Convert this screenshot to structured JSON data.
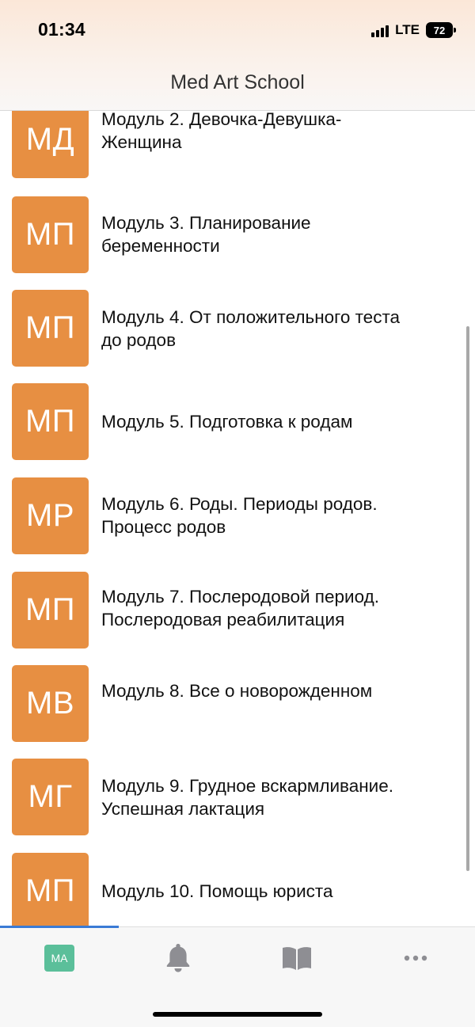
{
  "status_bar": {
    "time": "01:34",
    "network": "LTE",
    "battery": "72"
  },
  "header": {
    "title": "Med Art School"
  },
  "modules": [
    {
      "initials": "МД",
      "lines": [
        "Модуль 2. Девочка-Девушка-",
        "Женщина"
      ]
    },
    {
      "initials": "МП",
      "lines": [
        "Модуль 3. Планирование",
        "беременности"
      ]
    },
    {
      "initials": "МП",
      "lines": [
        "Модуль 4. От положительного теста",
        "до родов"
      ]
    },
    {
      "initials": "МП",
      "lines": [
        "Модуль 5. Подготовка к родам"
      ]
    },
    {
      "initials": "МР",
      "lines": [
        "Модуль 6. Роды. Периоды родов.",
        "Процесс родов"
      ]
    },
    {
      "initials": "МП",
      "lines": [
        "Модуль 7. Послеродовой период.",
        "Послеродовая реабилитация"
      ]
    },
    {
      "initials": "МВ",
      "lines": [
        "Модуль 8. Все о новорожденном"
      ]
    },
    {
      "initials": "МГ",
      "lines": [
        "Модуль 9. Грудное вскармливание.",
        "Успешная лактация"
      ]
    },
    {
      "initials": "МП",
      "lines": [
        "Модуль 10. Помощь юриста"
      ]
    }
  ],
  "tabbar": {
    "home_badge": "MA",
    "tabs": [
      {
        "icon": "home-badge-icon"
      },
      {
        "icon": "bell-icon"
      },
      {
        "icon": "book-icon"
      },
      {
        "icon": "more-icon"
      }
    ]
  },
  "colors": {
    "module_avatar": "#e78f42",
    "home_badge": "#5bbf9a",
    "tab_indicator": "#3a7bd5",
    "tab_icon": "#8e8e93"
  }
}
